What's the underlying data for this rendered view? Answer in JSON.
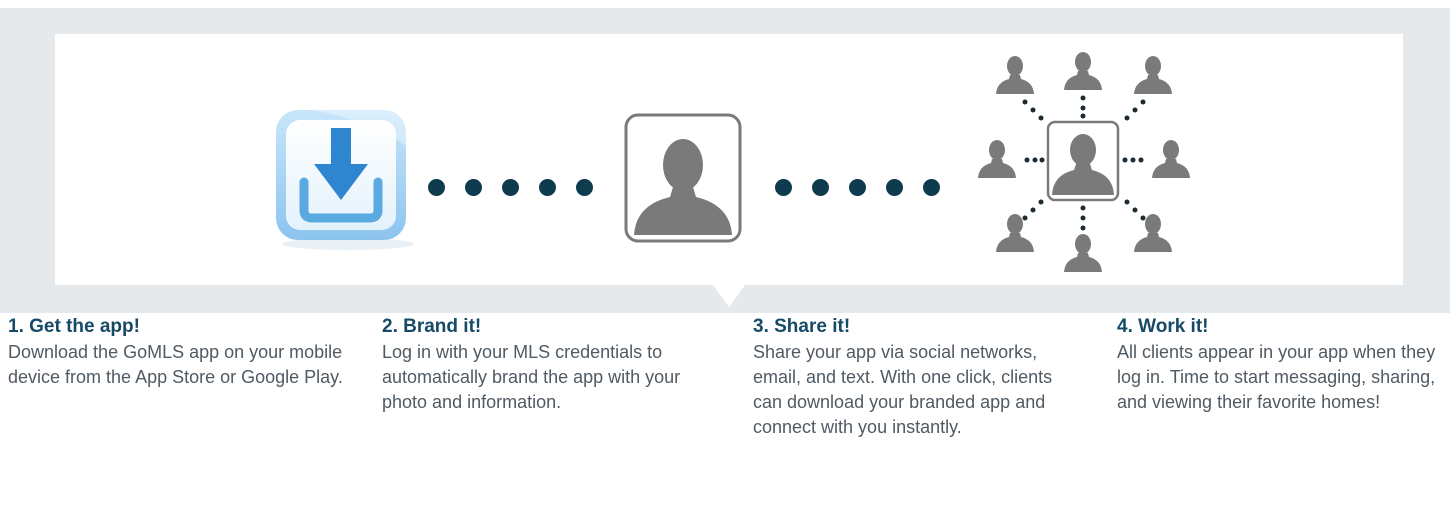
{
  "steps": [
    {
      "title": "1. Get the app!",
      "text": "Download the GoMLS app on your mobile device from the App Store or Google Play."
    },
    {
      "title": "2. Brand it!",
      "text": "Log in with your MLS credentials to automatically brand the app with your photo and information."
    },
    {
      "title": "3. Share it!",
      "text": "Share your app via social networks, email, and text. With one click, clients can download your branded app and connect with you instantly."
    },
    {
      "title": "4. Work it!",
      "text": "All clients appear in your app when they log in. Time to start messaging, sharing, and viewing their favorite homes!"
    }
  ],
  "colors": {
    "title": "#164a66",
    "body_text": "#505a63",
    "dot": "#0f3b4f",
    "person_icon": "#7a7a7a",
    "download_blue": "#2f86d0",
    "panel_frame": "#e6e9ec"
  },
  "icons": [
    "download-app-icon",
    "agent-profile-icon",
    "client-network-icon"
  ]
}
